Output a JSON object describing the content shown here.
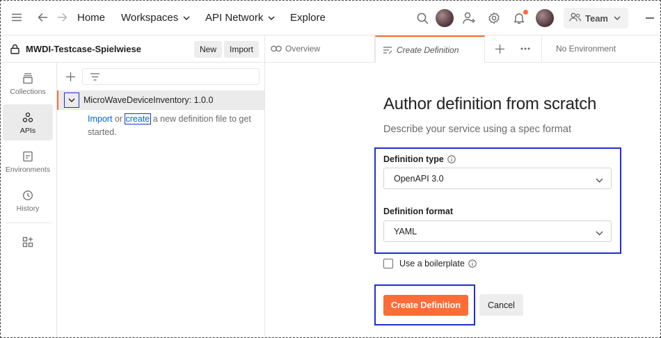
{
  "topbar": {
    "nav": [
      "Home",
      "Workspaces",
      "API Network",
      "Explore"
    ],
    "team_label": "Team",
    "icons": [
      "menu-icon",
      "back-arrow-icon",
      "forward-arrow-icon",
      "search-icon",
      "add-user-icon",
      "gear-icon",
      "bell-icon",
      "chevron-down-icon"
    ]
  },
  "workspace": {
    "name": "MWDI-Testcase-Spielwiese",
    "new_label": "New",
    "import_label": "Import"
  },
  "tabs": {
    "overview": "Overview",
    "create_definition": "Create Definition",
    "environment": "No Environment"
  },
  "rail": {
    "collections": "Collections",
    "apis": "APIs",
    "environments": "Environments",
    "history": "History"
  },
  "tree": {
    "api_name": "MicroWaveDeviceInventory: 1.0.0",
    "hint_import": "Import",
    "hint_or": " or ",
    "hint_create": "create",
    "hint_rest": " a new definition file to get started."
  },
  "main": {
    "title": "Author definition from scratch",
    "subtitle": "Describe your service using a spec format",
    "definition_type_label": "Definition type",
    "definition_type_value": "OpenAPI 3.0",
    "definition_format_label": "Definition format",
    "definition_format_value": "YAML",
    "boilerplate_label": "Use a boilerplate",
    "boilerplate_checked": false,
    "create_button": "Create Definition",
    "cancel_button": "Cancel"
  },
  "colors": {
    "accent": "#ff6c37",
    "highlight_box": "#1f2fc9",
    "link": "#0265d2"
  }
}
